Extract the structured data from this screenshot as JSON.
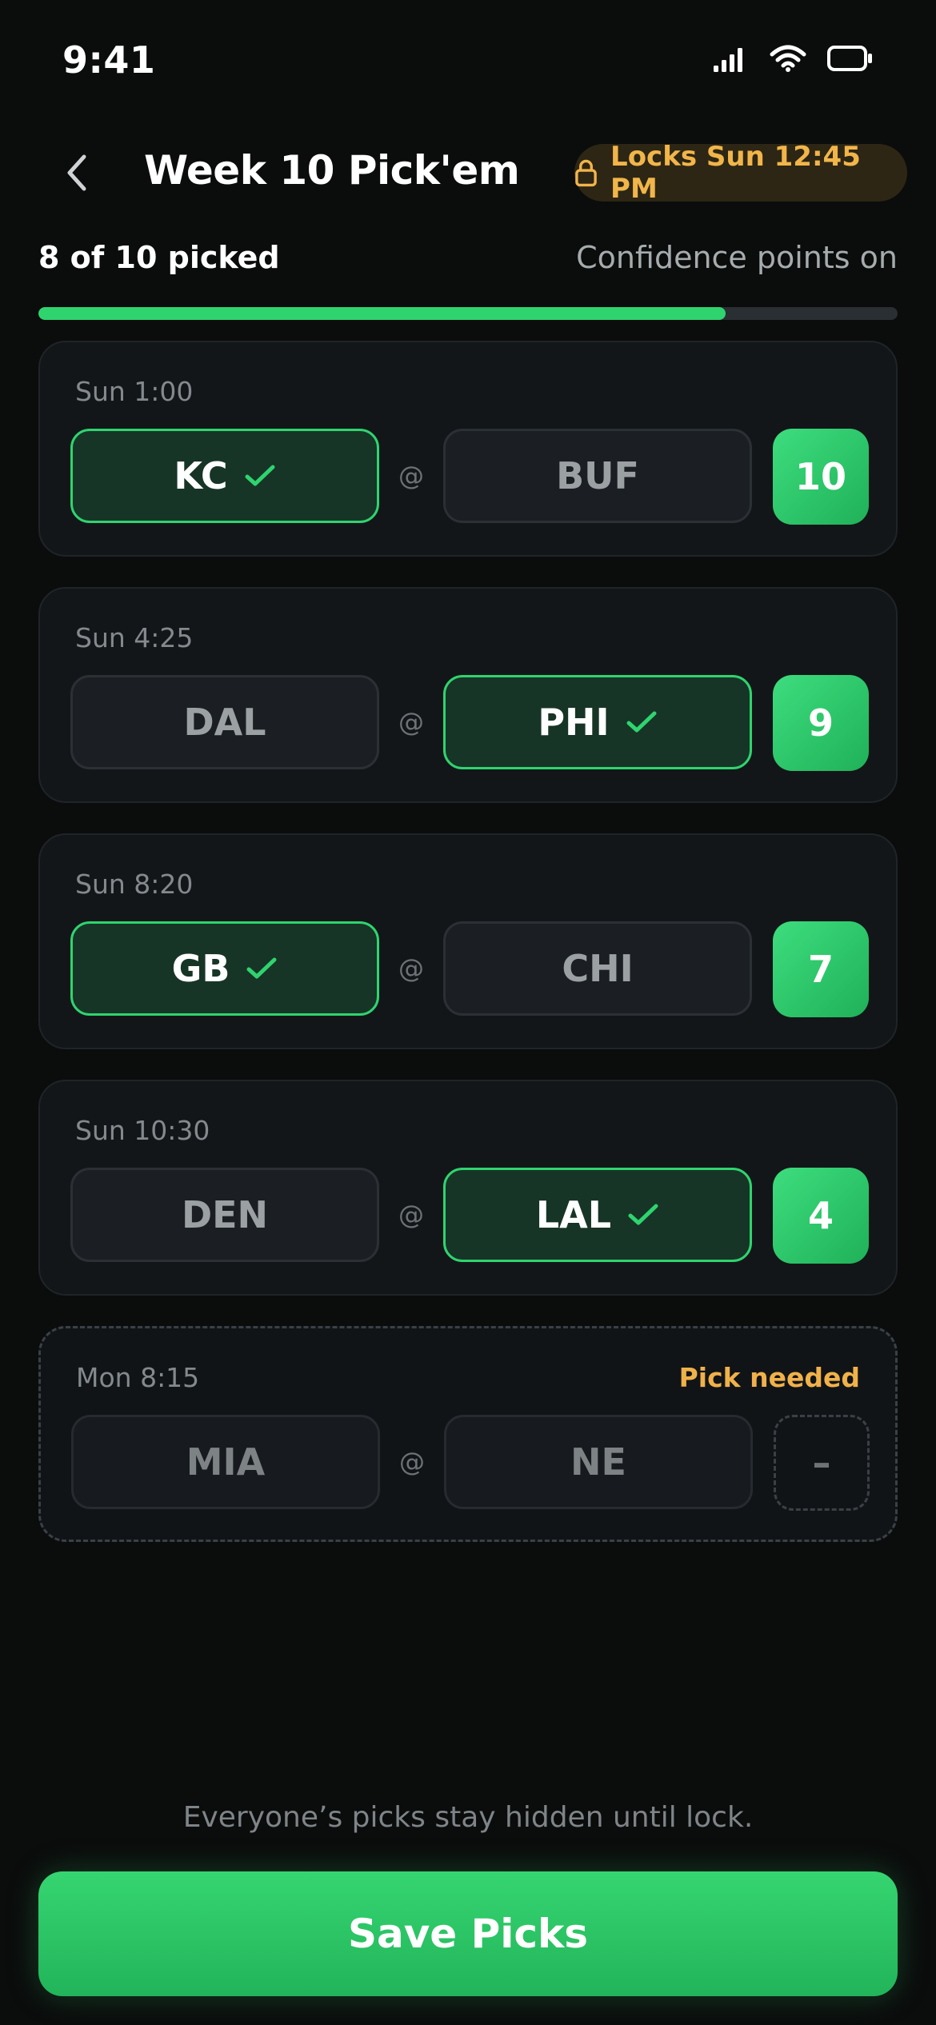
{
  "status_bar": {
    "time": "9:41"
  },
  "header": {
    "title": "Week 10 Pick'em",
    "lock_text": "Locks Sun 12:45 PM"
  },
  "progress": {
    "picked_label": "8 of 10 picked",
    "confidence_label": "Confidence points on",
    "fraction": 0.8
  },
  "games": [
    {
      "time": "Sun 1:00",
      "away": "KC",
      "home": "BUF",
      "at": "@",
      "pick": "away",
      "points": "10"
    },
    {
      "time": "Sun 4:25",
      "away": "DAL",
      "home": "PHI",
      "at": "@",
      "pick": "home",
      "points": "9"
    },
    {
      "time": "Sun 8:20",
      "away": "GB",
      "home": "CHI",
      "at": "@",
      "pick": "away",
      "points": "7"
    },
    {
      "time": "Sun 10:30",
      "away": "DEN",
      "home": "LAL",
      "at": "@",
      "pick": "home",
      "points": "4"
    },
    {
      "time": "Mon 8:15",
      "away": "MIA",
      "home": "NE",
      "at": "@",
      "pick": "none",
      "points": "–",
      "status": "Pick needed"
    }
  ],
  "footer": {
    "note": "Everyone’s picks stay hidden until lock.",
    "save_label": "Save Picks"
  },
  "colors": {
    "accent": "#2fd46f",
    "warning": "#f0b14a",
    "background": "#0b0c0c"
  },
  "icons": [
    "signal-icon",
    "wifi-icon",
    "battery-icon",
    "back-chevron-icon",
    "lock-icon",
    "checkmark-icon"
  ]
}
